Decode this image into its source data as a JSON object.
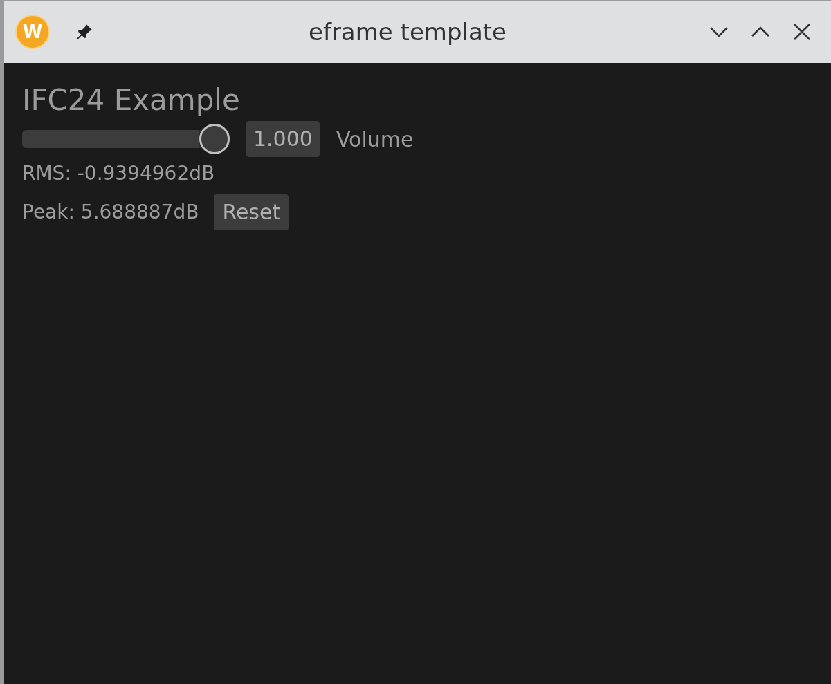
{
  "window": {
    "title": "eframe template",
    "app_icon_letter": "W"
  },
  "heading": "IFC24 Example",
  "volume": {
    "level": 1.0,
    "value": "1.000",
    "label": "Volume"
  },
  "rms": "RMS: -0.9394962dB",
  "peak": {
    "text": "Peak: 5.688887dB",
    "button": "Reset"
  }
}
